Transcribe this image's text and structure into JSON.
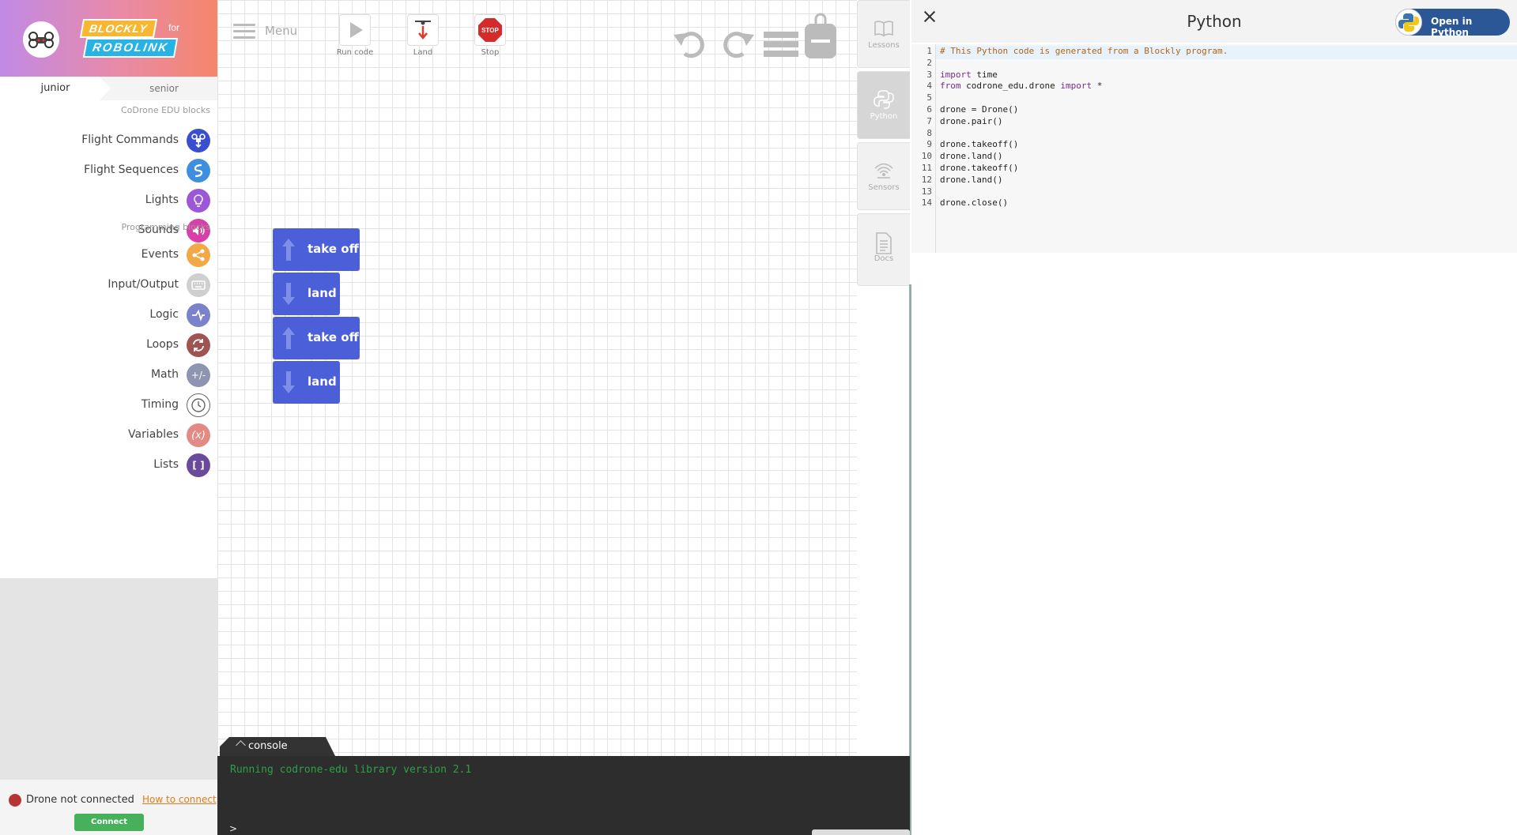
{
  "sidebar": {
    "logo": {
      "word1": "BLOCKLY",
      "for": "for",
      "word2": "ROBOLINK"
    },
    "tabs": {
      "junior": "junior",
      "senior": "senior"
    },
    "section1": "CoDrone EDU blocks",
    "section2": "Programming blocks",
    "categories": [
      {
        "label": "Flight Commands",
        "color": "#3a4fcf"
      },
      {
        "label": "Flight Sequences",
        "color": "#3f8fe0"
      },
      {
        "label": "Lights",
        "color": "#9c57d6"
      },
      {
        "label": "Sounds",
        "color": "#d93fa8"
      },
      {
        "label": "Events",
        "color": "#f2a844"
      },
      {
        "label": "Input/Output",
        "color": "#cfcfcf"
      },
      {
        "label": "Logic",
        "color": "#7b82c9"
      },
      {
        "label": "Loops",
        "color": "#9e5450"
      },
      {
        "label": "Math",
        "color": "#8e95b0",
        "glyph": "+/-"
      },
      {
        "label": "Timing",
        "color": "#ffffff"
      },
      {
        "label": "Variables",
        "color": "#e48a85",
        "glyph": "(x)"
      },
      {
        "label": "Lists",
        "color": "#6a4a9b",
        "glyph": "[ ]"
      }
    ],
    "status": {
      "text": "Drone not connected",
      "link": "How to connect",
      "button": "Connect"
    }
  },
  "toolbar": {
    "menu": "Menu",
    "run": "Run code",
    "land": "Land",
    "stop": "Stop",
    "stop_sign": "STOP"
  },
  "blocks": [
    {
      "label": "take off",
      "kind": "up"
    },
    {
      "label": "land",
      "kind": "down"
    },
    {
      "label": "take off",
      "kind": "up"
    },
    {
      "label": "land",
      "kind": "down"
    }
  ],
  "side_tabs": {
    "lessons": "Lessons",
    "python": "Python",
    "sensors": "Sensors",
    "docs": "Docs"
  },
  "console": {
    "tab": "console",
    "output": "Running codrone-edu library version 2.1",
    "prompt": ">"
  },
  "python": {
    "title": "Python",
    "open_button": "Open in Python",
    "lines": [
      {
        "n": "1",
        "t": "# This Python code is generated from a Blockly program."
      },
      {
        "n": "2",
        "t": ""
      },
      {
        "n": "3",
        "t": "import time"
      },
      {
        "n": "4",
        "t": "from codrone_edu.drone import *"
      },
      {
        "n": "5",
        "t": ""
      },
      {
        "n": "6",
        "t": "drone = Drone()"
      },
      {
        "n": "7",
        "t": "drone.pair()"
      },
      {
        "n": "8",
        "t": ""
      },
      {
        "n": "9",
        "t": "drone.takeoff()"
      },
      {
        "n": "10",
        "t": "drone.land()"
      },
      {
        "n": "11",
        "t": "drone.takeoff()"
      },
      {
        "n": "12",
        "t": "drone.land()"
      },
      {
        "n": "13",
        "t": ""
      },
      {
        "n": "14",
        "t": "drone.close()"
      }
    ]
  }
}
